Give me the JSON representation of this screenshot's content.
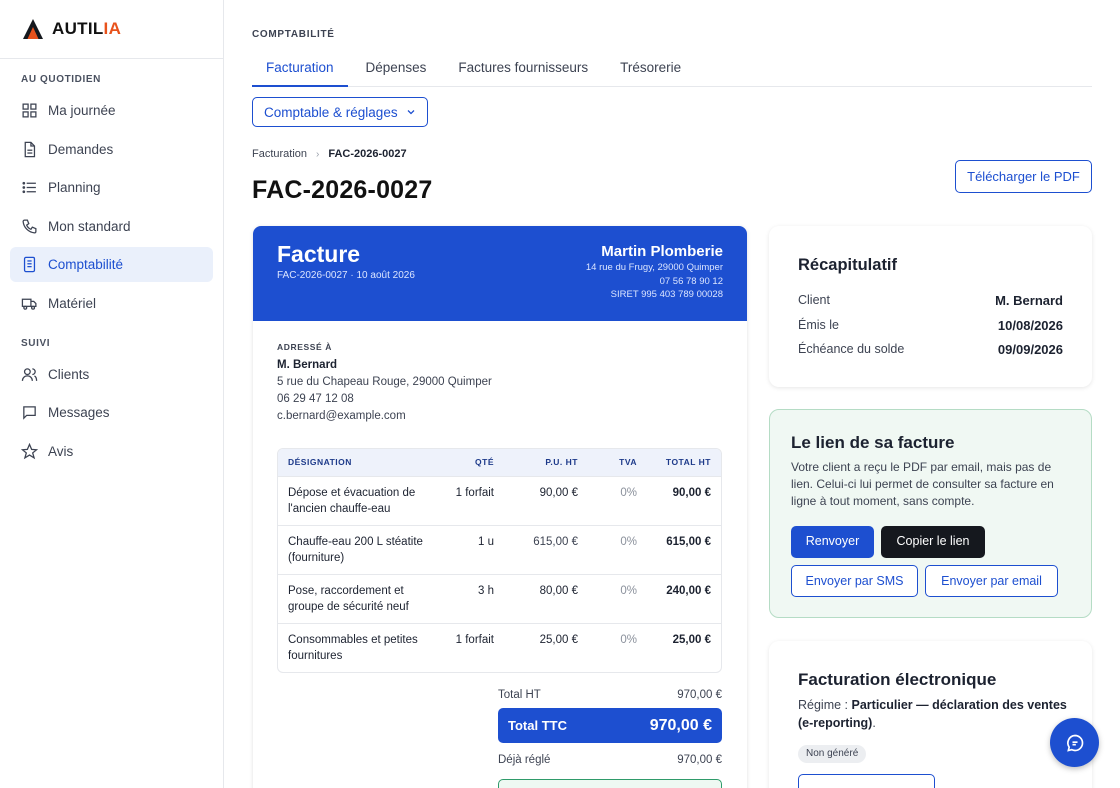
{
  "brand": {
    "name_main": "AUTIL",
    "name_accent": "IA",
    "accent_color": "#e8521c",
    "primary_color": "#1d4fd0"
  },
  "sidebar": {
    "section_daily": "AU QUOTIDIEN",
    "section_follow": "SUIVI",
    "items": [
      {
        "label": "Ma journée",
        "icon": "grid-icon"
      },
      {
        "label": "Demandes",
        "icon": "document-icon"
      },
      {
        "label": "Planning",
        "icon": "list-icon"
      },
      {
        "label": "Mon standard",
        "icon": "phone-icon"
      },
      {
        "label": "Comptabilité",
        "icon": "ledger-icon",
        "active": true
      },
      {
        "label": "Matériel",
        "icon": "truck-icon"
      },
      {
        "label": "Clients",
        "icon": "users-icon"
      },
      {
        "label": "Messages",
        "icon": "message-icon"
      },
      {
        "label": "Avis",
        "icon": "star-icon"
      }
    ]
  },
  "header": {
    "section_label": "COMPTABILITÉ",
    "tabs": [
      "Facturation",
      "Dépenses",
      "Factures fournisseurs",
      "Trésorerie"
    ],
    "active_tab": "Facturation",
    "select_label": "Comptable & réglages",
    "breadcrumb": [
      "Facturation",
      "FAC-2026-0027"
    ],
    "title": "FAC-2026-0027",
    "pdf_button": "Télécharger le PDF"
  },
  "invoice": {
    "title": "Facture",
    "subtitle": "FAC-2026-0027 · 10 août 2026",
    "vendor": {
      "name": "Martin Plomberie",
      "address": "14 rue du Frugy, 29000 Quimper",
      "phone": "07 56 78 90 12",
      "siret": "SIRET 995 403 789 00028"
    },
    "addressed_label": "ADRESSÉ À",
    "client": {
      "name": "M. Bernard",
      "address": "5 rue du Chapeau Rouge, 29000 Quimper",
      "phone": "06 29 47 12 08",
      "email": "c.bernard@example.com"
    },
    "columns": [
      "DÉSIGNATION",
      "QTÉ",
      "P.U. HT",
      "TVA",
      "TOTAL HT"
    ],
    "lines": [
      {
        "designation": "Dépose et évacuation de l'ancien chauffe-eau",
        "qty": "1 forfait",
        "pu": "90,00 €",
        "tva": "0%",
        "total": "90,00 €"
      },
      {
        "designation": "Chauffe-eau 200 L stéatite (fourniture)",
        "qty": "1 u",
        "pu": "615,00 €",
        "tva": "0%",
        "total": "615,00 €"
      },
      {
        "designation": "Pose, raccordement et groupe de sécurité neuf",
        "qty": "3 h",
        "pu": "80,00 €",
        "tva": "0%",
        "total": "240,00 €"
      },
      {
        "designation": "Consommables et petites fournitures",
        "qty": "1 forfait",
        "pu": "25,00 €",
        "tva": "0%",
        "total": "25,00 €"
      }
    ],
    "totals": {
      "ht_label": "Total HT",
      "ht_value": "970,00 €",
      "ttc_label": "Total TTC",
      "ttc_value": "970,00 €",
      "paid_label": "Déjà réglé",
      "paid_value": "970,00 €"
    }
  },
  "recap": {
    "title": "Récapitulatif",
    "rows": [
      {
        "label": "Client",
        "value": "M. Bernard"
      },
      {
        "label": "Émis le",
        "value": "10/08/2026"
      },
      {
        "label": "Échéance du solde",
        "value": "09/09/2026"
      }
    ]
  },
  "share": {
    "title": "Le lien de sa facture",
    "text": "Votre client a reçu le PDF par email, mais pas de lien. Celui-ci lui permet de consulter sa facture en ligne à tout moment, sans compte.",
    "resend": "Renvoyer",
    "copy": "Copier le lien",
    "sms": "Envoyer par SMS",
    "email": "Envoyer par email"
  },
  "einvoice": {
    "title": "Facturation électronique",
    "regime_label": "Régime :",
    "regime_value": "Particulier — déclaration des ventes (e-reporting)",
    "regime_end": ".",
    "badge": "Non généré"
  }
}
